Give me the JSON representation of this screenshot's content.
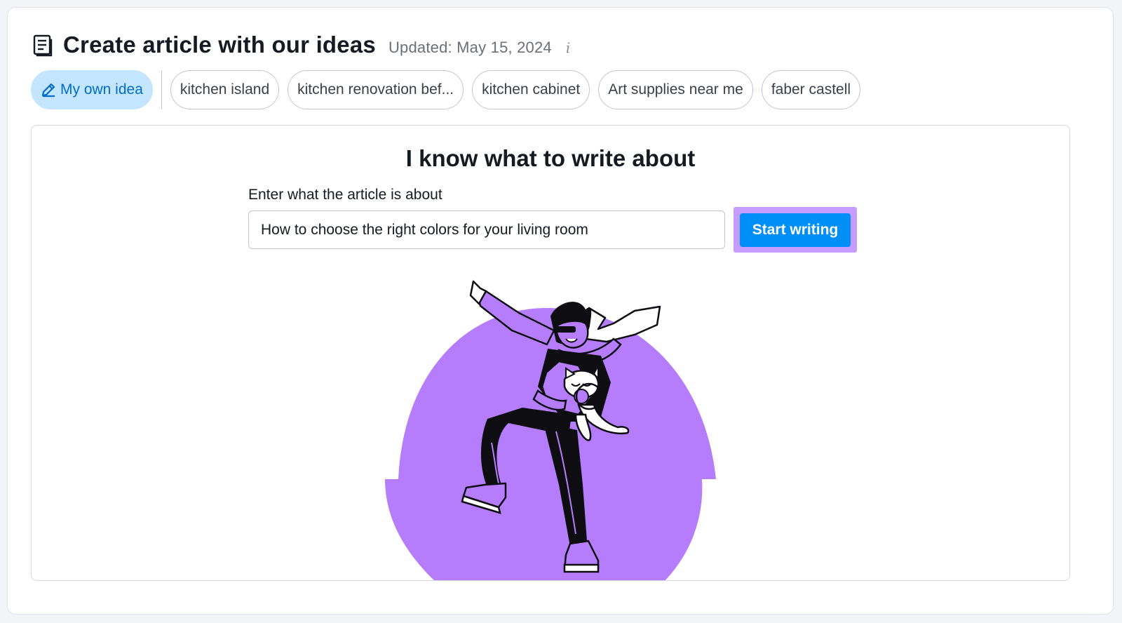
{
  "header": {
    "title": "Create article with our ideas",
    "updated": "Updated: May 15, 2024",
    "info_glyph": "i"
  },
  "chips": {
    "active_label": "My own idea",
    "items": [
      {
        "label": "kitchen island"
      },
      {
        "label": "kitchen renovation bef..."
      },
      {
        "label": "kitchen cabinet"
      },
      {
        "label": "Art supplies near me"
      },
      {
        "label": "faber castell"
      }
    ]
  },
  "form": {
    "heading": "I know what to write about",
    "label": "Enter what the article is about",
    "input_value": "How to choose the right colors for your living room",
    "button_label": "Start writing"
  },
  "colors": {
    "accent_blue": "#008ff8",
    "chip_active_bg": "#c4e5fe",
    "highlight_purple": "#c79cff",
    "illustration_purple": "#b57dfc"
  },
  "icons": [
    "document-icon",
    "info-icon",
    "pencil-icon"
  ]
}
